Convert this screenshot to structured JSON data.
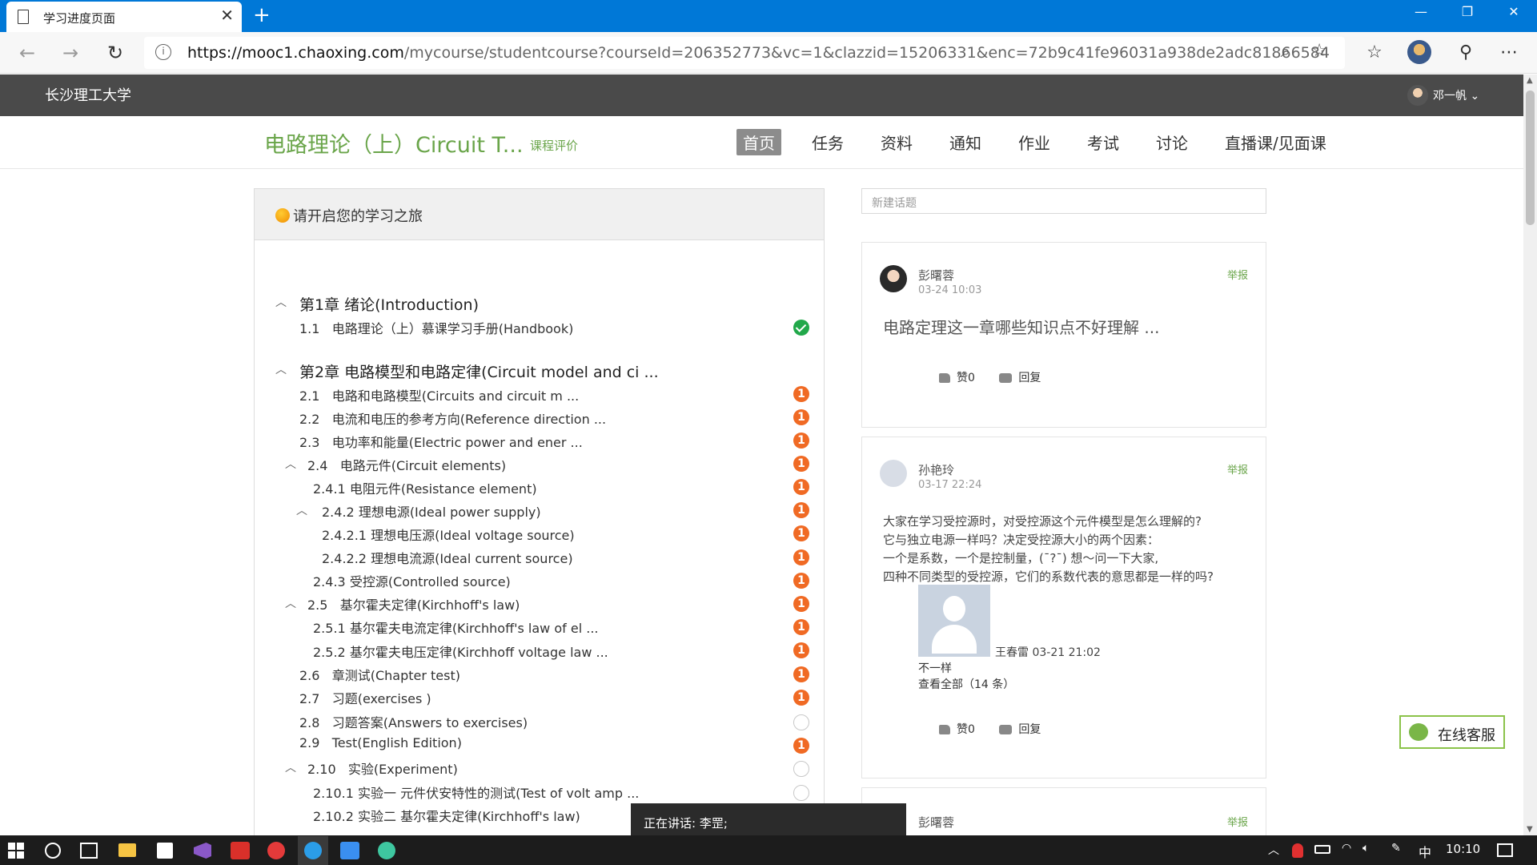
{
  "browser": {
    "tab_title": "学习进度页面",
    "url_host": "https://mooc1.chaoxing.com",
    "url_path": "/mycourse/studentcourse?courseId=206352773&vc=1&clazzid=15206331&enc=72b9c41fe96031a938de2adc81866584"
  },
  "site": {
    "university": "长沙理工大学",
    "username": "邓一帆"
  },
  "course": {
    "title": "电路理论（上）Circuit T...",
    "eval_link": "课程评价",
    "nav": [
      "首页",
      "任务",
      "资料",
      "通知",
      "作业",
      "考试",
      "讨论",
      "直播课/见面课"
    ]
  },
  "catalog": {
    "header": "请开启您的学习之旅",
    "chapter1": {
      "title": "第1章 绪论(Introduction)"
    },
    "chapter2": {
      "title": "第2章 电路模型和电路定律(Circuit model and ci ..."
    },
    "items": [
      {
        "num": "1.1",
        "label": "电路理论（上）慕课学习手册(Handbook)",
        "status": "done"
      },
      {
        "num": "2.1",
        "label": "电路和电路模型(Circuits and circuit m ...",
        "status": "pending"
      },
      {
        "num": "2.2",
        "label": "电流和电压的参考方向(Reference direction ...",
        "status": "pending"
      },
      {
        "num": "2.3",
        "label": "电功率和能量(Electric power and ener ...",
        "status": "pending"
      },
      {
        "num": "2.4",
        "label": "电路元件(Circuit elements)",
        "status": "pending"
      },
      {
        "num": "2.4.1",
        "label": "电阻元件(Resistance element)",
        "status": "pending"
      },
      {
        "num": "2.4.2",
        "label": "理想电源(Ideal power supply)",
        "status": "pending"
      },
      {
        "num": "2.4.2.1",
        "label": "理想电压源(Ideal voltage source)",
        "status": "pending"
      },
      {
        "num": "2.4.2.2",
        "label": "理想电流源(Ideal current source)",
        "status": "pending"
      },
      {
        "num": "2.4.3",
        "label": "受控源(Controlled source)",
        "status": "pending"
      },
      {
        "num": "2.5",
        "label": "基尔霍夫定律(Kirchhoff's law)",
        "status": "pending"
      },
      {
        "num": "2.5.1",
        "label": "基尔霍夫电流定律(Kirchhoff's law of el ...",
        "status": "pending"
      },
      {
        "num": "2.5.2",
        "label": "基尔霍夫电压定律(Kirchhoff voltage law ...",
        "status": "pending"
      },
      {
        "num": "2.6",
        "label": "章测试(Chapter test)",
        "status": "pending"
      },
      {
        "num": "2.7",
        "label": "习题(exercises )",
        "status": "pending"
      },
      {
        "num": "2.8",
        "label": "习题答案(Answers to exercises)",
        "status": "empty"
      },
      {
        "num": "2.9",
        "label": "Test(English Edition)",
        "status": "pending"
      },
      {
        "num": "2.10",
        "label": "实验(Experiment)",
        "status": "empty"
      },
      {
        "num": "2.10.1",
        "label": "实验一 元件伏安特性的测试(Test of volt amp ...",
        "status": "empty"
      },
      {
        "num": "2.10.2",
        "label": "实验二 基尔霍夫定律(Kirchhoff's law)",
        "status": "none"
      }
    ],
    "pending_badge": "1"
  },
  "discussion": {
    "new_topic_placeholder": "新建话题",
    "report": "举报",
    "like": "赞0",
    "reply": "回复",
    "posts": [
      {
        "author": "彭曙蓉",
        "time": "03-24 10:03",
        "body": "电路定理这一章哪些知识点不好理解 ..."
      },
      {
        "author": "孙艳玲",
        "time": "03-17 22:24",
        "lines": [
          "大家在学习受控源时，对受控源这个元件模型是怎么理解的?",
          "它与独立电源一样吗？决定受控源大小的两个因素：",
          "一个是系数，一个是控制量，(¯?¯) 想～问一下大家,",
          "四种不同类型的受控源，它们的系数代表的意思都是一样的吗?"
        ],
        "reply_author_time": "王春雷 03-21 21:02",
        "reply_text": "不一样",
        "view_all": "查看全部（14 条）"
      },
      {
        "author": "彭曙蓉"
      }
    ]
  },
  "service": "在线客服",
  "toast": "正在讲话: 李罡;",
  "taskbar": {
    "ime": "中",
    "time": "10:10"
  }
}
